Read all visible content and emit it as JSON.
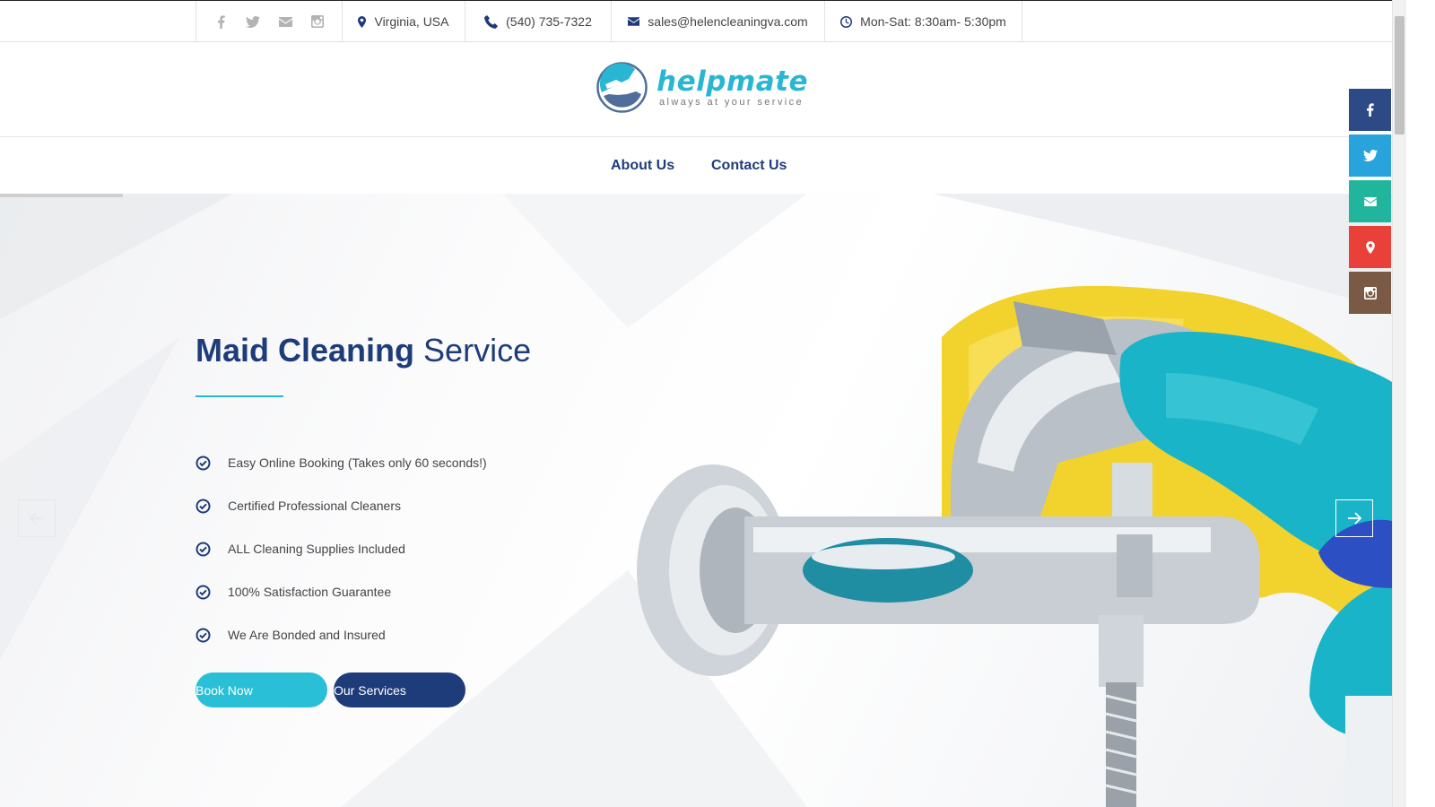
{
  "topbar": {
    "social_icons": [
      "facebook-icon",
      "twitter-icon",
      "mail-icon",
      "instagram-icon"
    ],
    "location": "Virginia, USA",
    "phone": "(540) 735-7322",
    "email": "sales@helencleaningva.com",
    "hours": "Mon-Sat: 8:30am- 5:30pm"
  },
  "logo": {
    "name": "helpmate",
    "tagline": "always at your service"
  },
  "nav": {
    "items": [
      {
        "label": "About Us"
      },
      {
        "label": "Contact Us"
      }
    ]
  },
  "hero": {
    "title_bold": "Maid Cleaning",
    "title_light": "Service",
    "features": [
      "Easy Online Booking (Takes only 60 seconds!)",
      "Certified Professional Cleaners",
      "ALL Cleaning Supplies Included",
      "100% Satisfaction Guarantee",
      "We Are Bonded and Insured"
    ],
    "book_button": "Book Now",
    "services_button": "Our Services"
  },
  "dock": [
    "facebook-icon",
    "twitter-icon",
    "mail-icon",
    "map-pin-icon",
    "instagram-icon"
  ],
  "colors": {
    "navy": "#1f3c7a",
    "cyan": "#29b6d3",
    "book_button": "#29bfd6",
    "dock_facebook": "#2d4a86",
    "dock_twitter": "#29a3db",
    "dock_mail": "#22b59e",
    "dock_map": "#e9403a",
    "dock_instagram": "#7a5a45"
  }
}
